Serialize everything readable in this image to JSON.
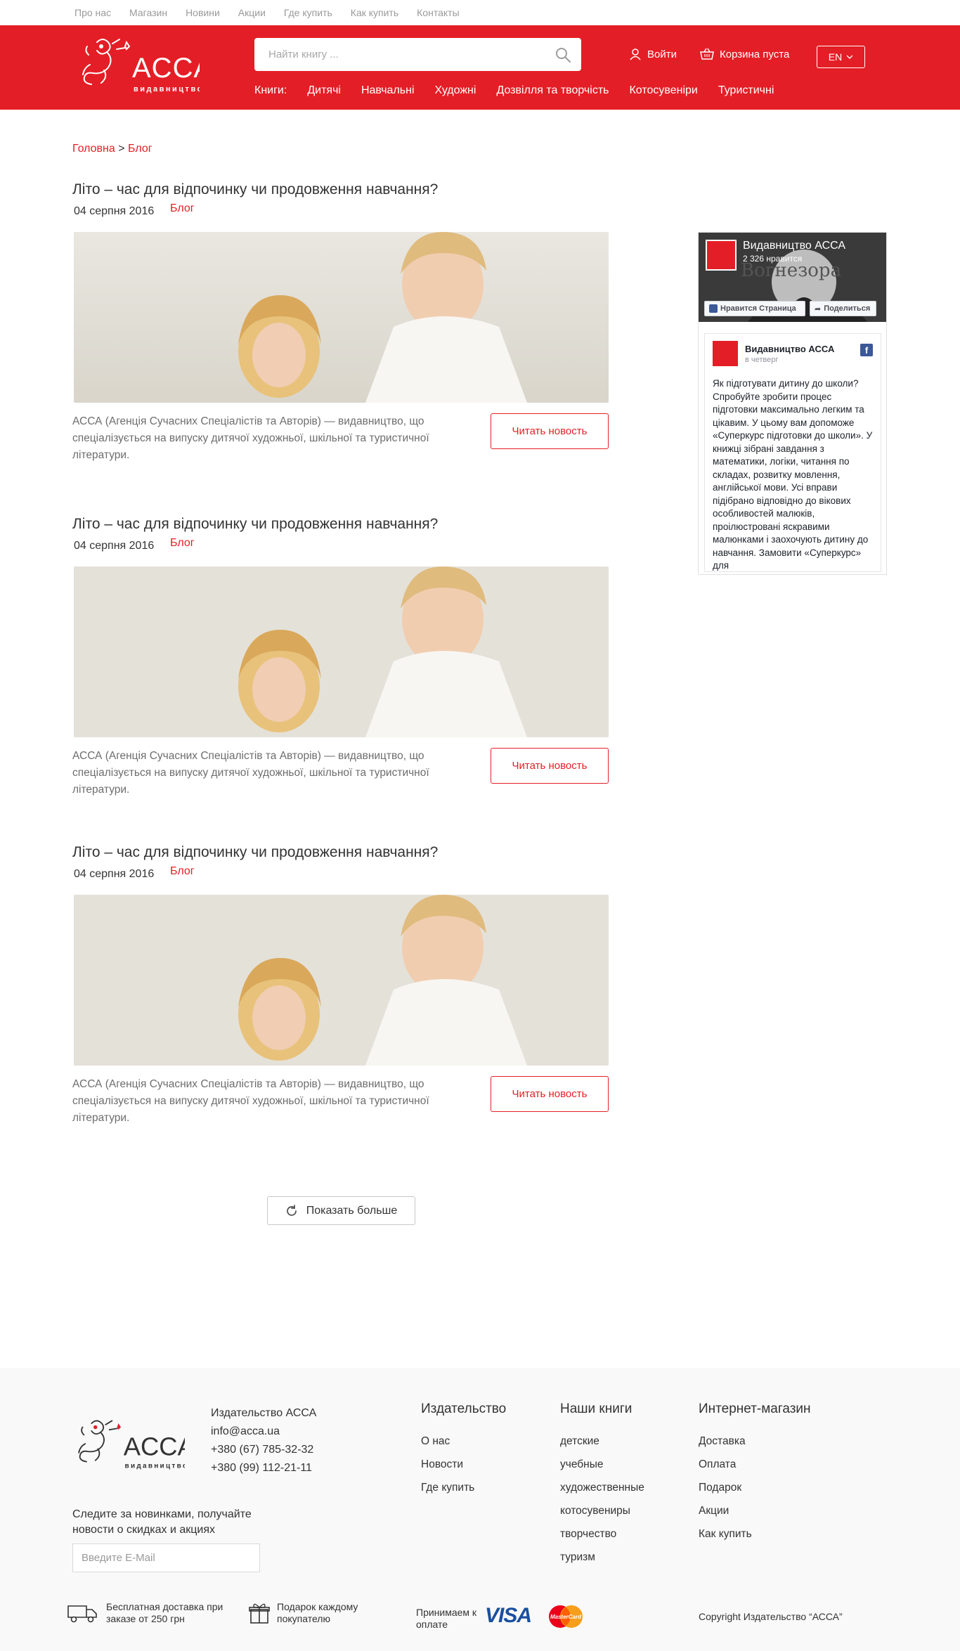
{
  "topnav": [
    "Про нас",
    "Магазин",
    "Новини",
    "Акции",
    "Где купить",
    "Как купить",
    "Контакты"
  ],
  "logo_text": "ACCA",
  "logo_subtext": "видавництво",
  "search": {
    "placeholder": "Найти книгу ..."
  },
  "login_label": "Войти",
  "cart_label": "Корзина пуста",
  "lang_label": "EN",
  "catnav": [
    "Книги:",
    "Дитячі",
    "Навчальні",
    "Художні",
    "Дозвілля та творчість",
    "Котосувеніри",
    "Туристичні"
  ],
  "breadcrumb": {
    "home": "Головна",
    "sep": " > ",
    "current": "Блог"
  },
  "posts": [
    {
      "title": "Літо – час для відпочинку чи продовження навчання?",
      "date": "04 серпня 2016",
      "tag": "Блог",
      "text": "АССА (Агенція Сучасних Спеціалістів та Авторів) — видавництво, що спеціалізується на випуску дитячої художньої, шкільної та туристичної літератури.",
      "button": "Читать новость"
    },
    {
      "title": "Літо – час для відпочинку чи продовження навчання?",
      "date": "04 серпня 2016",
      "tag": "Блог",
      "text": "АССА (Агенція Сучасних Спеціалістів та Авторів) — видавництво, що спеціалізується на випуску дитячої художньої, шкільної та туристичної літератури.",
      "button": "Читать новость"
    },
    {
      "title": "Літо – час для відпочинку чи продовження навчання?",
      "date": "04 серпня 2016",
      "tag": "Блог",
      "text": "АССА (Агенція Сучасних Спеціалістів та Авторів) — видавництво, що спеціалізується на випуску дитячої художньої, шкільної та туристичної літератури.",
      "button": "Читать новость"
    }
  ],
  "more_button": "Показать больше",
  "facebook": {
    "page_name": "Видавництво АССА",
    "likes": "2 326 нравится",
    "cover_text": "Вогнезора",
    "like_button": "Нравится Страница",
    "share_button": "Поделиться",
    "post_author": "Видавництво АССА",
    "post_date": "в четверг",
    "post_text": "Як підготувати дитину до школи? Спробуйте зробити процес підготовки максимально легким та цікавим. У цьому вам допоможе «Суперкурс підготовки до школи». У книжці зібрані завдання з математики, логіки, читання по складах, розвитку мовлення, англійської мови. Усі вправи підібрано відповідно до вікових особливостей малюків, проілюстровані яскравими малюнками і заохочують дитину до навчання. Замовити «Суперкурс» для"
  },
  "footer": {
    "contact": [
      "Издательство АССА",
      "info@acca.ua",
      "+380 (67) 785-32-32",
      "+380 (99) 112-21-11"
    ],
    "columns": [
      {
        "title": "Издательство",
        "items": [
          "О нас",
          "Новости",
          "Где купить"
        ]
      },
      {
        "title": "Наши книги",
        "items": [
          "детские",
          "учебные",
          "художественные",
          "котосувениры",
          "творчество",
          "туризм"
        ]
      },
      {
        "title": "Интернет-магазин",
        "items": [
          "Доставка",
          "Оплата",
          "Подарок",
          "Акции",
          "Как купить"
        ]
      }
    ],
    "subscribe_text": "Следите за новинками, получайте новости о скидках и акциях",
    "email_placeholder": "Введите E-Mail",
    "delivery_text": "Бесплатная доставка при заказе от 250 грн",
    "gift_text": "Подарок каждому покупателю",
    "pay_text": "Принимаем к оплате",
    "visa_text": "VISA",
    "mastercard_text": "MasterCard",
    "copyright": "Copyright Издательство “АССА”"
  },
  "colors": {
    "brand_red": "#e41e26",
    "footer_bg": "#f9f9f9"
  }
}
